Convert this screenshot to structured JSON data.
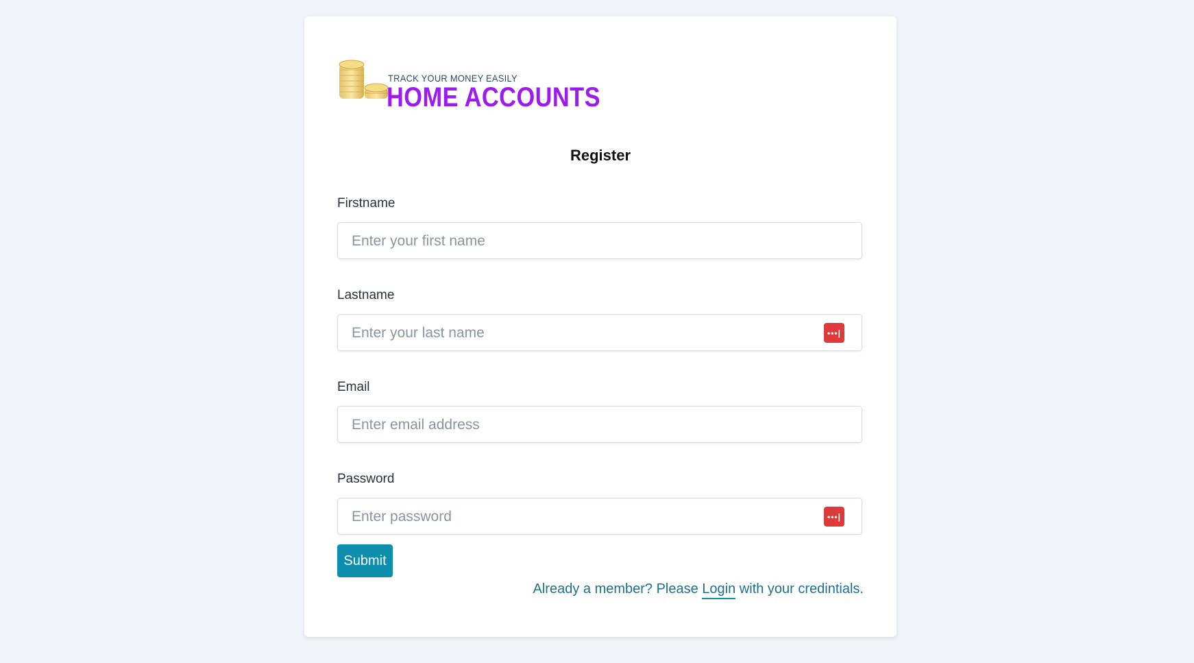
{
  "brand": {
    "tagline": "TRACK YOUR MONEY EASILY",
    "name": "HOME ACCOUNTS",
    "logo_icon": "coins-icon"
  },
  "form": {
    "title": "Register",
    "fields": [
      {
        "label": "Firstname",
        "placeholder": "Enter your first name",
        "value": ""
      },
      {
        "label": "Lastname",
        "placeholder": "Enter your last name",
        "value": ""
      },
      {
        "label": "Email",
        "placeholder": "Enter email address",
        "value": ""
      },
      {
        "label": "Password",
        "placeholder": "Enter password",
        "value": ""
      }
    ],
    "password_manager_icon": "password-manager-icon",
    "password_manager_glyph": "•••|",
    "submit_label": "Submit",
    "login_prefix": "Already a member? Please ",
    "login_link": "Login",
    "login_suffix": " with your credintials."
  },
  "colors": {
    "background": "#f0f4f8",
    "brand_purple": "#9b1bf0",
    "button": "#0d8ead",
    "link": "#1c6f8c",
    "password_icon": "#dd3b3b"
  }
}
